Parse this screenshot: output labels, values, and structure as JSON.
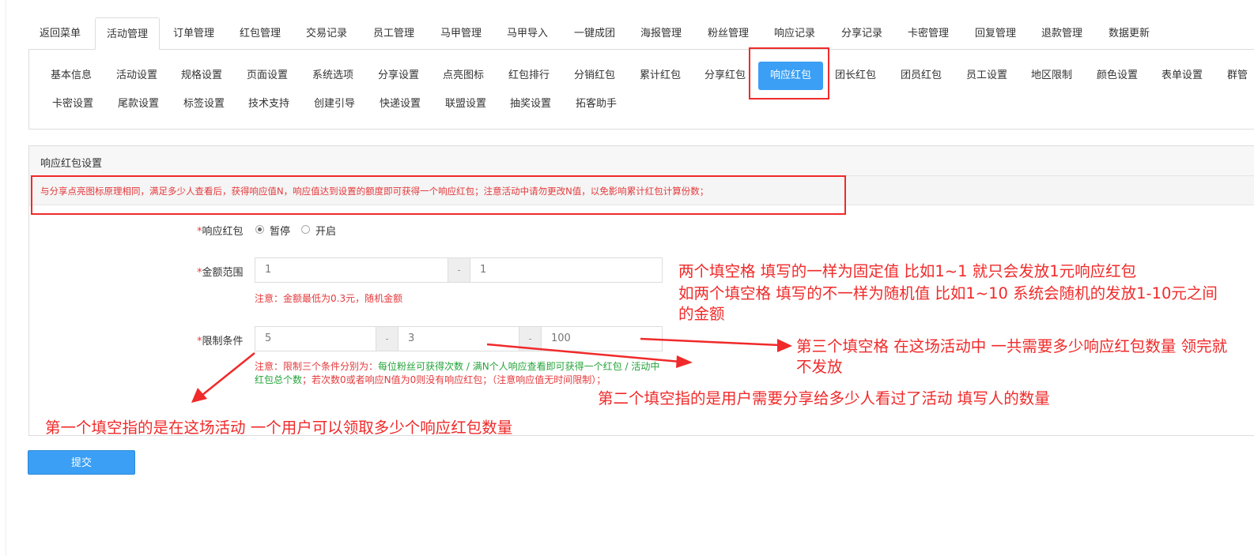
{
  "top_tabs": [
    {
      "label": "返回菜单"
    },
    {
      "label": "活动管理"
    },
    {
      "label": "订单管理"
    },
    {
      "label": "红包管理"
    },
    {
      "label": "交易记录"
    },
    {
      "label": "员工管理"
    },
    {
      "label": "马甲管理"
    },
    {
      "label": "马甲导入"
    },
    {
      "label": "一键成团"
    },
    {
      "label": "海报管理"
    },
    {
      "label": "粉丝管理"
    },
    {
      "label": "响应记录"
    },
    {
      "label": "分享记录"
    },
    {
      "label": "卡密管理"
    },
    {
      "label": "回复管理"
    },
    {
      "label": "退款管理"
    },
    {
      "label": "数据更新"
    }
  ],
  "sub_tabs_row1": [
    {
      "label": "基本信息"
    },
    {
      "label": "活动设置"
    },
    {
      "label": "规格设置"
    },
    {
      "label": "页面设置"
    },
    {
      "label": "系统选项"
    },
    {
      "label": "分享设置"
    },
    {
      "label": "点亮图标"
    },
    {
      "label": "红包排行"
    },
    {
      "label": "分销红包"
    },
    {
      "label": "累计红包"
    },
    {
      "label": "分享红包"
    },
    {
      "label": "响应红包"
    },
    {
      "label": "团长红包"
    },
    {
      "label": "团员红包"
    },
    {
      "label": "员工设置"
    },
    {
      "label": "地区限制"
    },
    {
      "label": "颜色设置"
    },
    {
      "label": "表单设置"
    },
    {
      "label": "群管"
    }
  ],
  "sub_tabs_row2": [
    {
      "label": "卡密设置"
    },
    {
      "label": "尾款设置"
    },
    {
      "label": "标签设置"
    },
    {
      "label": "技术支持"
    },
    {
      "label": "创建引导"
    },
    {
      "label": "快递设置"
    },
    {
      "label": "联盟设置"
    },
    {
      "label": "抽奖设置"
    },
    {
      "label": "拓客助手"
    }
  ],
  "panel": {
    "title": "响应红包设置",
    "notice": "与分享点亮图标原理相同，满足多少人查看后，获得响应值N，响应值达到设置的额度即可获得一个响应红包；注意活动中请勿更改N值，以免影响累计红包计算份数；"
  },
  "form": {
    "required_mark": "*",
    "toggle": {
      "label": "响应红包",
      "option_pause": "暂停",
      "option_on": "开启"
    },
    "amount": {
      "label": "金额范围",
      "min": "1",
      "max": "1",
      "separator": "-",
      "hint": "注意：金额最低为0.3元，随机金额"
    },
    "limit": {
      "label": "限制条件",
      "v1": "5",
      "v2": "3",
      "v3": "100",
      "separator": "-",
      "hint_prefix": "注意：限制三个条件分别为：",
      "hint_g1": "每位粉丝可获得次数 / 满N个人响应查看即可获得一个红包 / 活动中红包总个数",
      "hint_rest": "；若次数0或者响应N值为0则没有响应红包；（注意响应值无时间限制）；"
    },
    "submit_label": "提交"
  },
  "annotations": {
    "amount_note_line1": "两个填空格  填写的一样为固定值 比如1~1 就只会发放1元响应红包",
    "amount_note_line2": "如两个填空格 填写的不一样为随机值 比如1~10 系统会随机的发放1-10元之间的金额",
    "third_field": "第三个填空格 在这场活动中 一共需要多少响应红包数量 领完就不发放",
    "second_field": "第二个填空指的是用户需要分享给多少人看过了活动 填写人的数量",
    "first_field": "第一个填空指的是在这场活动 一个用户可以领取多少个响应红包数量"
  },
  "colors": {
    "accent": "#3a9ff5",
    "annotation_red": "#f02a2a",
    "hint_red": "#e4393c",
    "hint_green": "#24a43a"
  }
}
